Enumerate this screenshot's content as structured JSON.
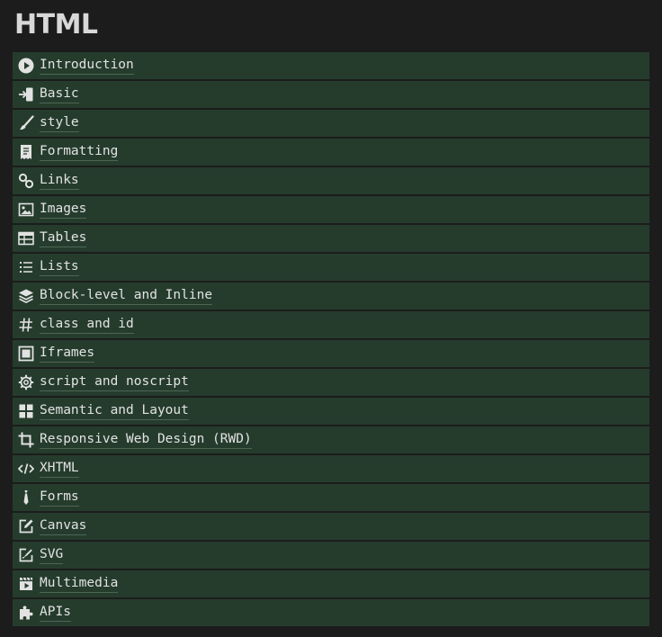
{
  "page": {
    "title": "HTML"
  },
  "menu": {
    "items": [
      {
        "label": "Introduction",
        "icon": "play-circle-icon"
      },
      {
        "label": "Basic",
        "icon": "sign-in-icon"
      },
      {
        "label": "style",
        "icon": "paint-brush-icon"
      },
      {
        "label": "Formatting",
        "icon": "receipt-icon"
      },
      {
        "label": "Links",
        "icon": "link-icon"
      },
      {
        "label": "Images",
        "icon": "image-icon"
      },
      {
        "label": "Tables",
        "icon": "table-icon"
      },
      {
        "label": "Lists",
        "icon": "list-icon"
      },
      {
        "label": "Block-level and Inline",
        "icon": "layers-icon"
      },
      {
        "label": "class and id",
        "icon": "hashtag-icon"
      },
      {
        "label": "Iframes",
        "icon": "window-frame-icon"
      },
      {
        "label": "script and noscript",
        "icon": "gear-icon"
      },
      {
        "label": "Semantic and Layout",
        "icon": "grid-icon"
      },
      {
        "label": "Responsive Web Design (RWD)",
        "icon": "crop-icon"
      },
      {
        "label": "XHTML",
        "icon": "code-icon"
      },
      {
        "label": "Forms",
        "icon": "tie-icon"
      },
      {
        "label": "Canvas",
        "icon": "edit-square-icon"
      },
      {
        "label": "SVG",
        "icon": "signature-pen-icon"
      },
      {
        "label": "Multimedia",
        "icon": "film-play-icon"
      },
      {
        "label": "APIs",
        "icon": "puzzle-icon"
      }
    ]
  },
  "colors": {
    "background": "#1c1c1c",
    "item_background": "#253c2d",
    "text": "#e2e2e2",
    "title": "#d8d8d8"
  }
}
